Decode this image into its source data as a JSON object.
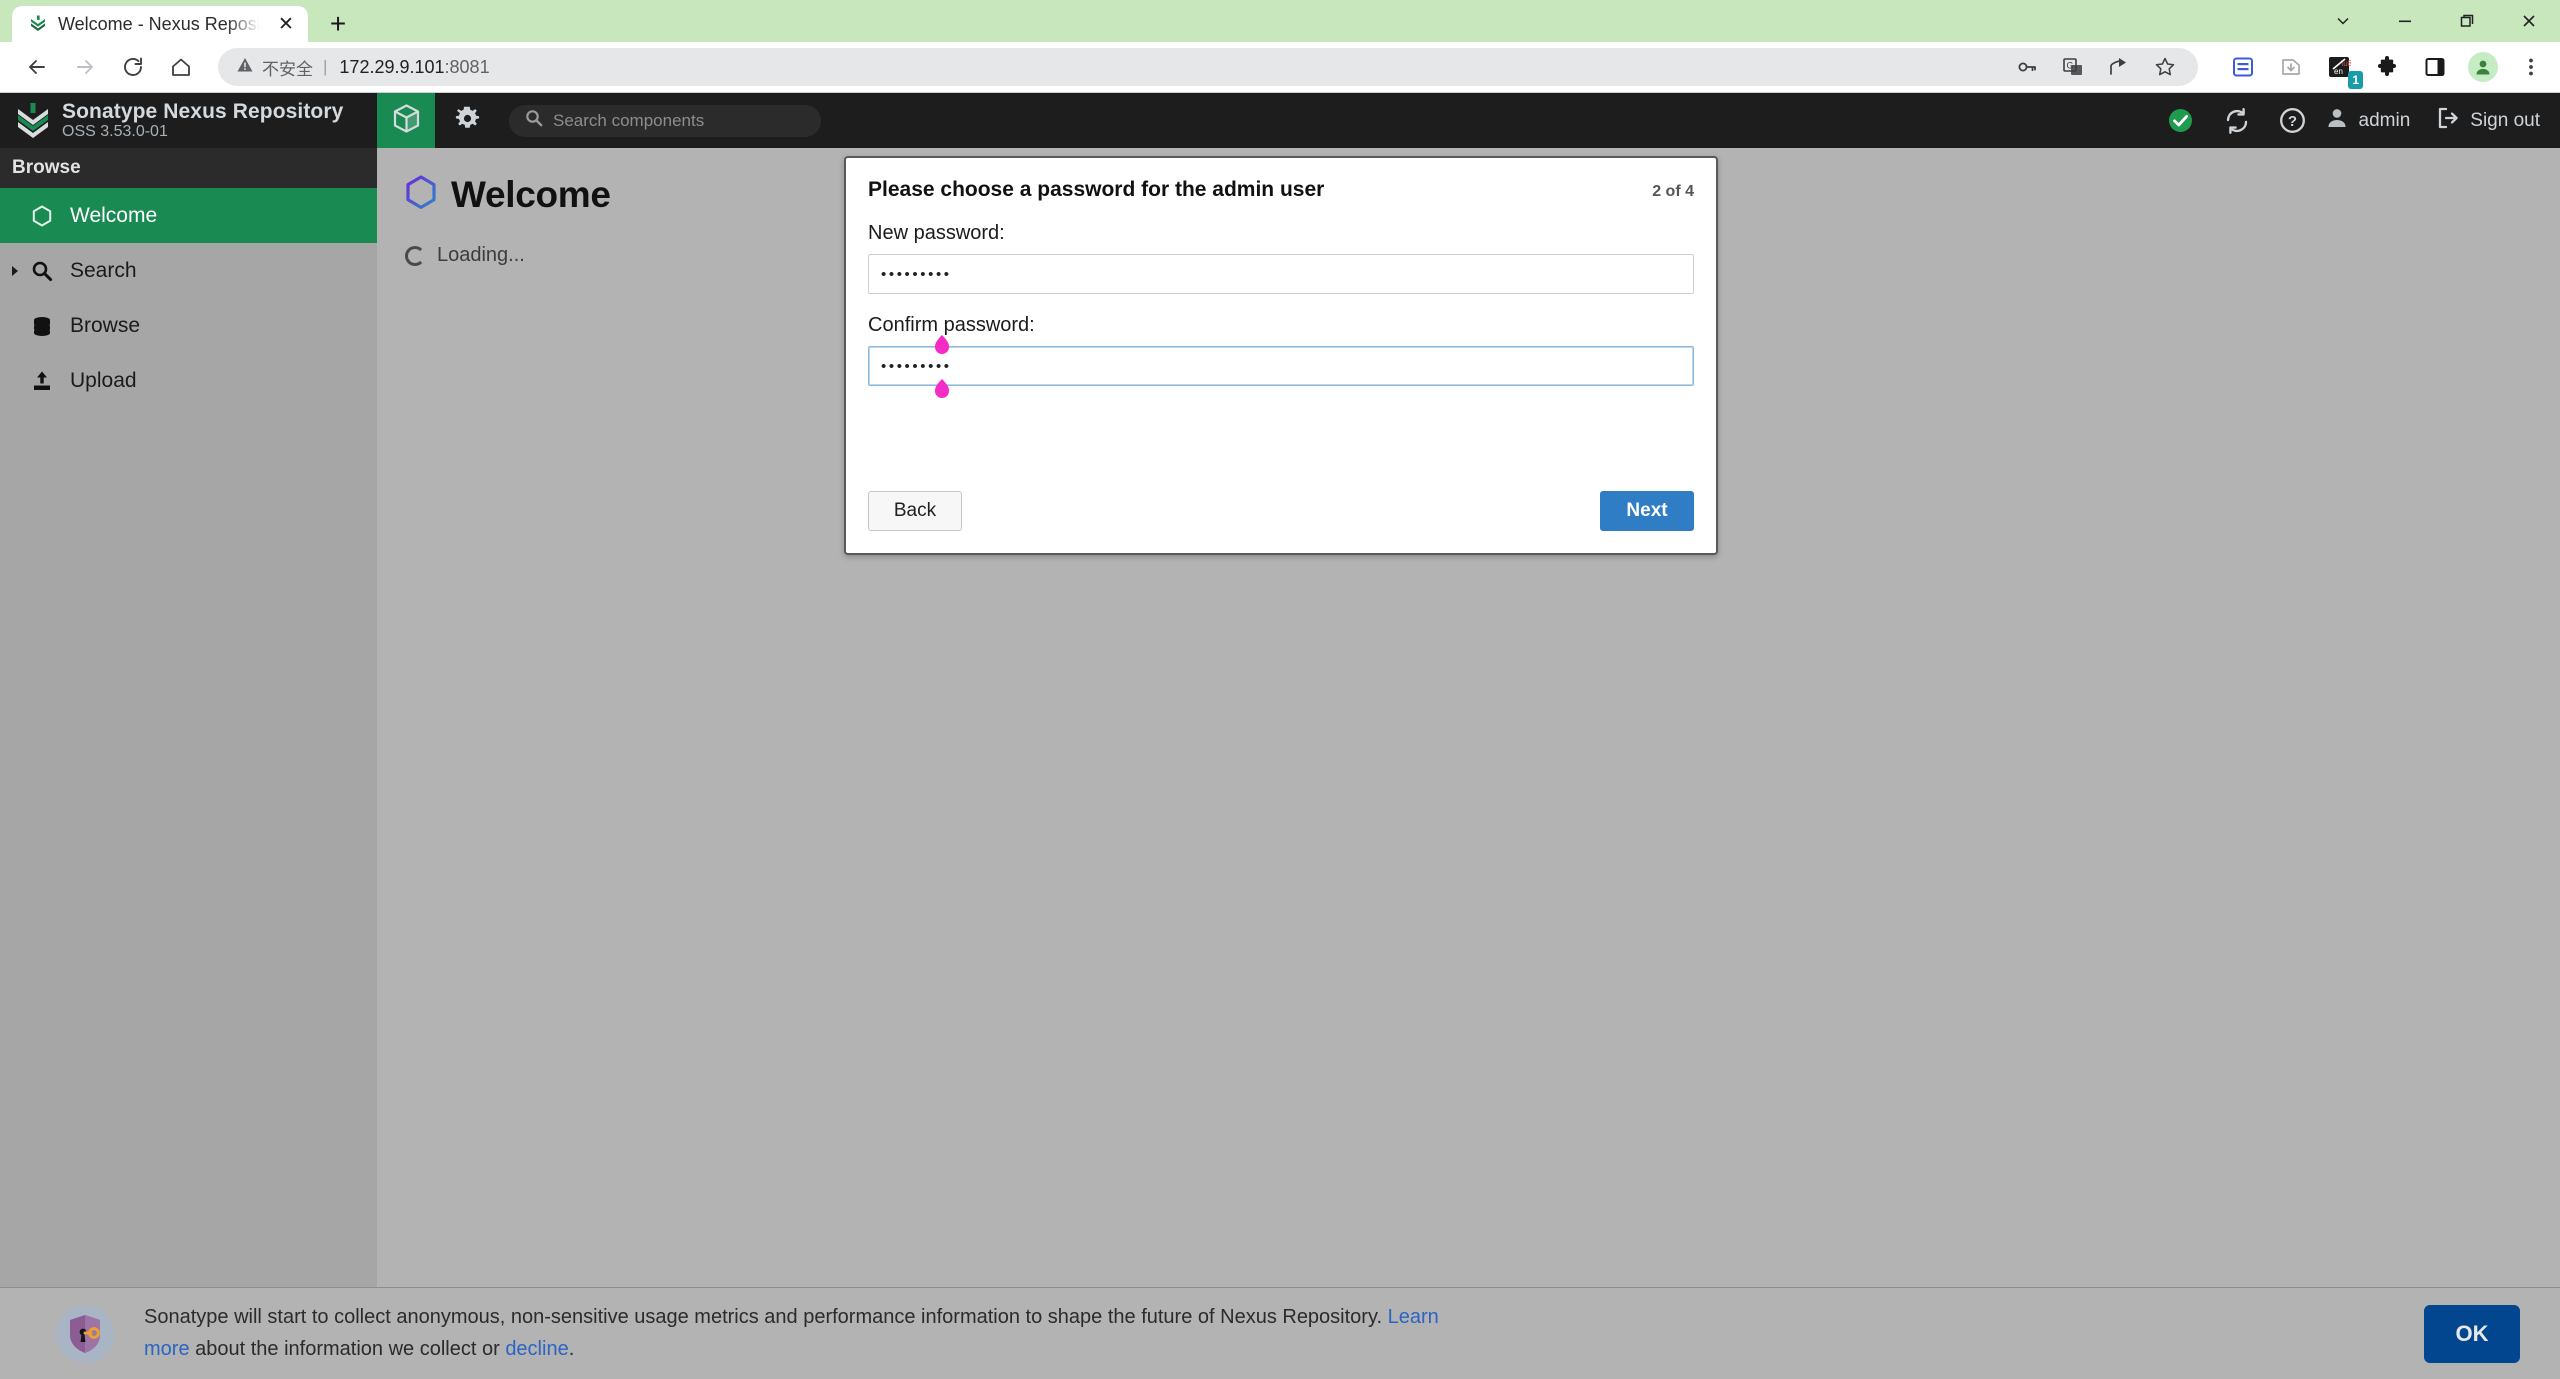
{
  "browser": {
    "tab": {
      "title": "Welcome - Nexus Repository M",
      "favicon": "sonatype-favicon",
      "close_label": "✕"
    },
    "new_tab_label": "+",
    "window_controls": {
      "tab_search": "tab-search-chevron",
      "minimize": "minimize",
      "restore": "restore",
      "close": "close"
    },
    "nav": {
      "back": "back-arrow",
      "forward": "forward-arrow",
      "reload": "reload",
      "home": "home"
    },
    "omnibox": {
      "security_label": "不安全",
      "separator": "|",
      "url": "172.29.9.101",
      "port": ":8081"
    },
    "toolbar_icons": [
      "password-key-icon",
      "translate-icon",
      "share-icon",
      "bookmark-star-icon",
      "reading-list-icon",
      "download-icon",
      "translation-extension-icon",
      "extensions-puzzle-icon",
      "side-panel-icon",
      "profile-avatar-icon",
      "chrome-menu-icon"
    ],
    "extension_badge": "1"
  },
  "app": {
    "brand": {
      "title": "Sonatype Nexus Repository",
      "version": "OSS 3.53.0-01",
      "logo": "sonatype-logo"
    },
    "header": {
      "browse_tab_icon": "cube-icon",
      "admin_tab_icon": "gear-icon",
      "search": {
        "placeholder": "Search components",
        "icon": "search-icon"
      },
      "status_icon": "health-check-ok-icon",
      "refresh_icon": "refresh-icon",
      "help_icon": "help-icon",
      "user_icon": "user-icon",
      "user_name": "admin",
      "signout_icon": "sign-out-icon",
      "signout_label": "Sign out"
    },
    "sidebar": {
      "heading": "Browse",
      "items": [
        {
          "label": "Welcome",
          "icon": "hexagon-icon",
          "selected": true,
          "expandable": false
        },
        {
          "label": "Search",
          "icon": "search-icon",
          "selected": false,
          "expandable": true
        },
        {
          "label": "Browse",
          "icon": "database-icon",
          "selected": false,
          "expandable": false
        },
        {
          "label": "Upload",
          "icon": "upload-icon",
          "selected": false,
          "expandable": false
        }
      ]
    },
    "page": {
      "title": "Welcome",
      "title_icon": "hexagon-gradient-icon",
      "loading_text": "Loading...",
      "loading_icon": "spinner-icon"
    },
    "modal": {
      "title": "Please choose a password for the admin user",
      "step": "2 of 4",
      "new_password_label": "New password:",
      "new_password_value": "•••••••••",
      "confirm_password_label": "Confirm password:",
      "confirm_password_value": "•••••••••",
      "back_label": "Back",
      "next_label": "Next",
      "selection_handle_color": "#f52bc6"
    },
    "banner": {
      "icon": "shield-key-icon",
      "text_part1": "Sonatype will start to collect anonymous, non-sensitive usage metrics and performance information to shape the future of Nexus Repository. ",
      "link_learn_more": "Learn more",
      "text_part2": " about the information we collect or ",
      "link_decline": "decline",
      "text_part3": ".",
      "ok_label": "OK"
    }
  },
  "colors": {
    "titlebar_green": "#c9e7bd",
    "nexus_dark": "#1d1d1d",
    "nexus_green": "#1a8a53",
    "sidebar_gray": "#a6a6a6",
    "content_gray": "#b3b3b3",
    "next_blue": "#2f7dc4",
    "ok_blue": "#01468f",
    "link_blue": "#2b64c4"
  }
}
